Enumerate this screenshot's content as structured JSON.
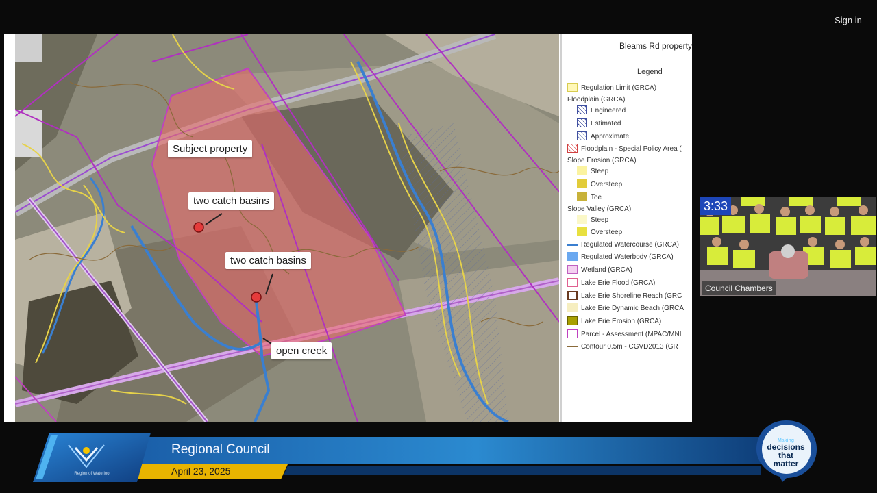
{
  "header": {
    "sign_in": "Sign in"
  },
  "slide": {
    "title": "Bleams Rd property",
    "legend_heading": "Legend",
    "legend": [
      {
        "label": "Regulation Limit (GRCA)"
      },
      {
        "label": "Floodplain (GRCA)"
      },
      {
        "label": "Engineered"
      },
      {
        "label": "Estimated"
      },
      {
        "label": "Approximate"
      },
      {
        "label": "Floodplain - Special Policy Area ("
      },
      {
        "label": "Slope Erosion (GRCA)"
      },
      {
        "label": "Steep"
      },
      {
        "label": "Oversteep"
      },
      {
        "label": "Toe"
      },
      {
        "label": "Slope Valley (GRCA)"
      },
      {
        "label": "Steep"
      },
      {
        "label": "Oversteep"
      },
      {
        "label": "Regulated Watercourse (GRCA)"
      },
      {
        "label": "Regulated Waterbody (GRCA)"
      },
      {
        "label": "Wetland (GRCA)"
      },
      {
        "label": "Lake Erie Flood (GRCA)"
      },
      {
        "label": "Lake Erie Shoreline Reach (GRC"
      },
      {
        "label": "Lake Erie Dynamic Beach (GRCA"
      },
      {
        "label": "Lake Erie Erosion (GRCA)"
      },
      {
        "label": "Parcel - Assessment (MPAC/MNI"
      },
      {
        "label": "Contour 0.5m - CGVD2013 (GR"
      }
    ],
    "map_labels": {
      "subject": "Subject property",
      "catch1": "two catch basins",
      "catch2": "two catch basins",
      "creek": "open creek"
    }
  },
  "video": {
    "timer": "3:33",
    "caption": "Council Chambers"
  },
  "lower_third": {
    "title": "Regional Council",
    "date": "April 23, 2025",
    "logo_caption": "Region of Waterloo",
    "badge_small": "Making",
    "badge_lines": [
      "decisions",
      "that",
      "matter"
    ]
  },
  "colors": {
    "accent_blue": "#1a5ea8",
    "date_band": "#e8b400",
    "property": "#e86a6a",
    "parcel_line": "#c040c0",
    "watercourse": "#3a7fd0",
    "timer_bg": "#1d46b8"
  }
}
